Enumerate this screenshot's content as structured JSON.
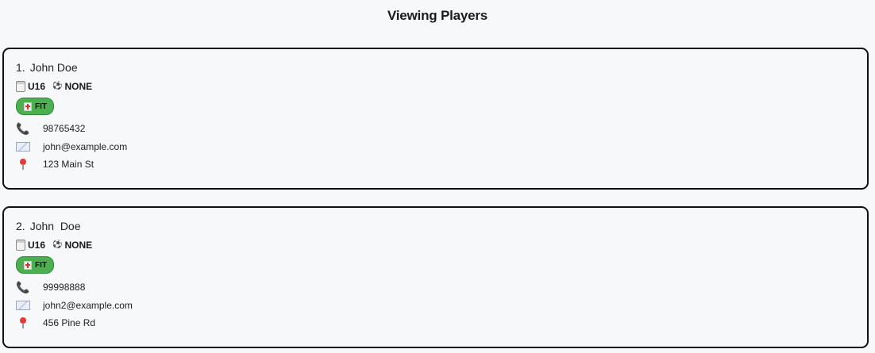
{
  "header": {
    "title": "Viewing Players"
  },
  "players": [
    {
      "index": "1.",
      "name": "John Doe",
      "age_group": "U16",
      "position": "NONE",
      "status": "FIT",
      "phone": "98765432",
      "email": "john@example.com",
      "address": "123 Main St"
    },
    {
      "index": "2.",
      "name": "John  Doe",
      "age_group": "U16",
      "position": "NONE",
      "status": "FIT",
      "phone": "99998888",
      "email": "john2@example.com",
      "address": "456 Pine Rd"
    }
  ],
  "icons": {
    "age_group": "calendar-icon",
    "position": "soccer-ball-icon",
    "status": "medical-cross-icon",
    "phone": "phone-icon",
    "email": "envelope-icon",
    "address": "pin-icon"
  },
  "colors": {
    "status_fit": "#4caf50",
    "card_border": "#111111",
    "background": "#f7f8fa"
  }
}
